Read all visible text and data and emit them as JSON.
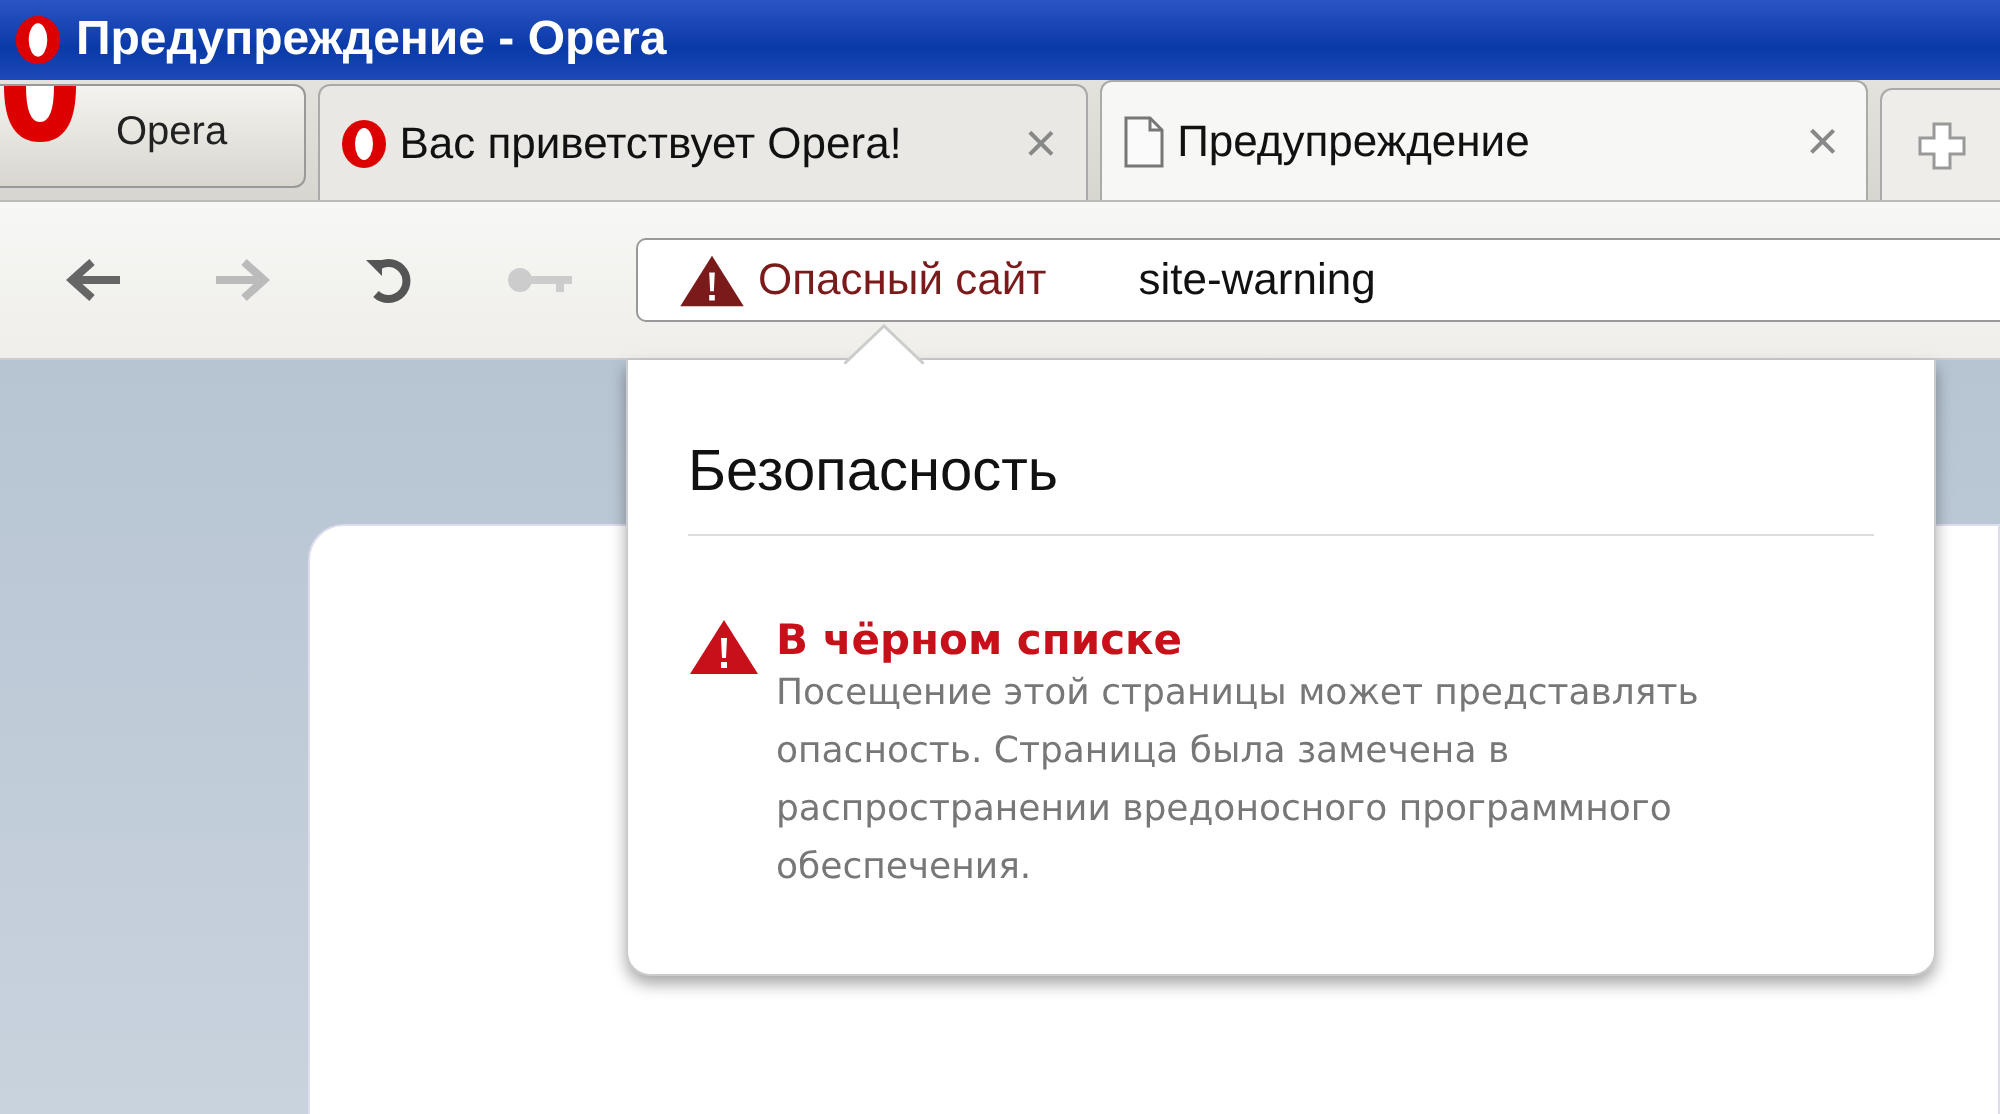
{
  "window": {
    "title": "Предупреждение - Opera"
  },
  "menu_button": {
    "label": "Opera"
  },
  "tabs": [
    {
      "title": "Вас приветствует Opera!",
      "kind": "opera",
      "selected": false,
      "close": "×"
    },
    {
      "title": "Предупреждение",
      "kind": "page",
      "selected": true,
      "close": "×"
    }
  ],
  "toolbar": {
    "address": {
      "badge": "Опасный сайт",
      "value": "site-warning"
    }
  },
  "popup": {
    "title": "Безопасность",
    "warning": {
      "heading": "В чёрном списке",
      "text": "Посещение этой страницы может представлять опасность. Страница была замечена в распространении вредоносного программного обеспечения."
    }
  }
}
